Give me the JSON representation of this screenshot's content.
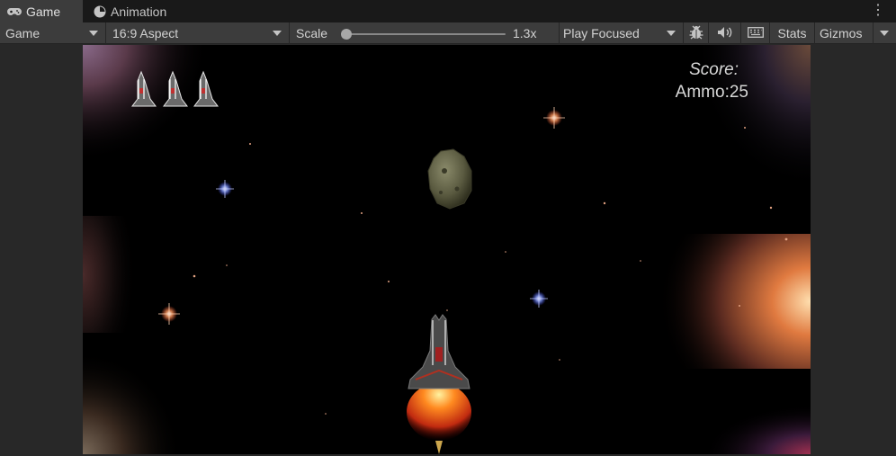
{
  "tabs": [
    {
      "label": "Game",
      "icon": "gamepad-icon",
      "active": true
    },
    {
      "label": "Animation",
      "icon": "animation-clock-icon",
      "active": false
    }
  ],
  "toolbar": {
    "display": "Game",
    "aspect": "16:9 Aspect",
    "scale_label": "Scale",
    "scale_value": "1.3x",
    "scale_slider_fraction": 0.03,
    "play_mode": "Play Focused",
    "stats_label": "Stats",
    "gizmos_label": "Gizmos"
  },
  "game": {
    "score_label": "Score:",
    "ammo_label": "Ammo:",
    "ammo_value": "25",
    "lives": 3
  },
  "colors": {
    "editor_bg": "#282828",
    "toolbar_bg": "#3c3c3c",
    "tab_active": "#3c3c3c",
    "space": "#000000",
    "thruster": "#ff6a1a"
  }
}
